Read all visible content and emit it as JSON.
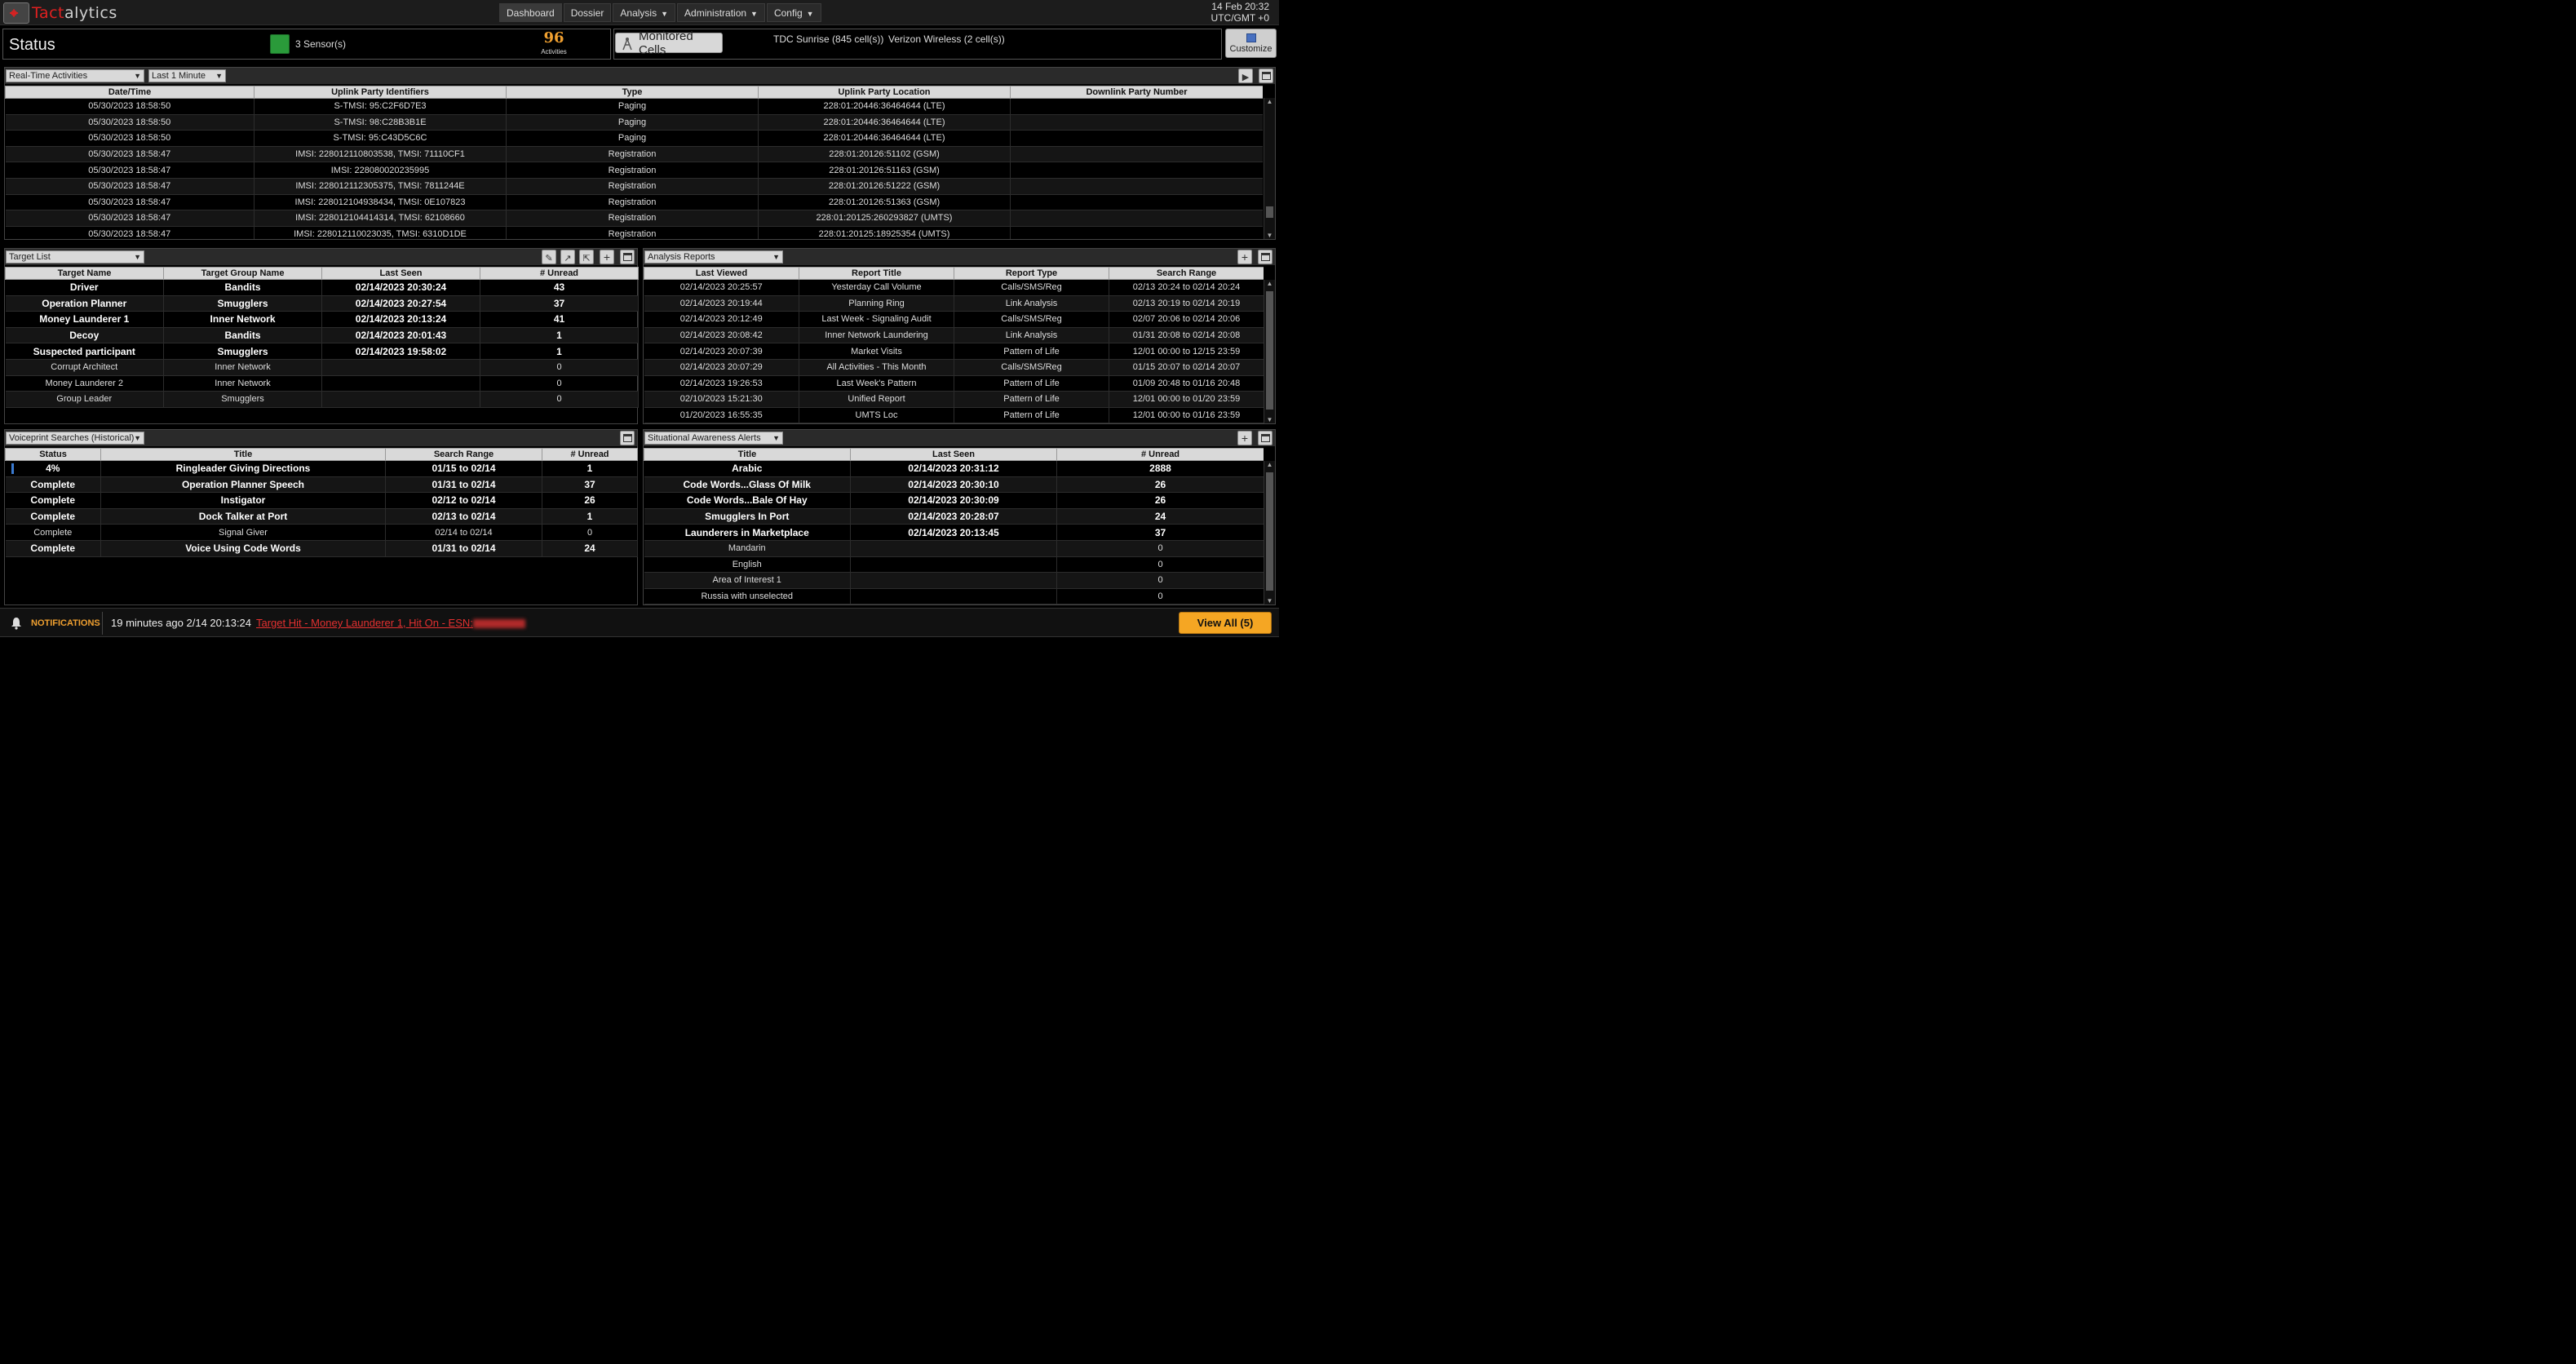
{
  "app": {
    "brand_red": "Tact",
    "brand_rest": "alytics",
    "logo_glyph": "⌖"
  },
  "nav": {
    "items": [
      {
        "label": "Dashboard",
        "dropdown": false
      },
      {
        "label": "Dossier",
        "dropdown": false
      },
      {
        "label": "Analysis",
        "dropdown": true
      },
      {
        "label": "Administration",
        "dropdown": true
      },
      {
        "label": "Config",
        "dropdown": true
      }
    ],
    "active": "Dashboard"
  },
  "clock": {
    "date": "14 Feb 20:32",
    "tz": "UTC/GMT +0"
  },
  "status": {
    "title": "Status",
    "sensors": "3 Sensor(s)",
    "sensor_color": "#2a9a3a",
    "activities_count": "96",
    "activities_label": "Activities"
  },
  "cells": {
    "button": "Monitored Cells",
    "items": [
      "TDC Sunrise (845 cell(s))",
      "Verizon Wireless (2 cell(s))"
    ]
  },
  "customize": {
    "label": "Customize"
  },
  "realtime": {
    "select": "Real-Time Activities",
    "range": "Last 1 Minute",
    "columns": [
      "Date/Time",
      "Uplink Party Identifiers",
      "Type",
      "Uplink Party Location",
      "Downlink Party Number"
    ],
    "rows": [
      [
        "05/30/2023 18:58:50",
        "S-TMSI: 95:C2F6D7E3",
        "Paging",
        "228:01:20446:36464644 (LTE)",
        ""
      ],
      [
        "05/30/2023 18:58:50",
        "S-TMSI: 98:C28B3B1E",
        "Paging",
        "228:01:20446:36464644 (LTE)",
        ""
      ],
      [
        "05/30/2023 18:58:50",
        "S-TMSI: 95:C43D5C6C",
        "Paging",
        "228:01:20446:36464644 (LTE)",
        ""
      ],
      [
        "05/30/2023 18:58:47",
        "IMSI: 228012110803538, TMSI: 71110CF1",
        "Registration",
        "228:01:20126:51102 (GSM)",
        ""
      ],
      [
        "05/30/2023 18:58:47",
        "IMSI: 228080020235995",
        "Registration",
        "228:01:20126:51163 (GSM)",
        ""
      ],
      [
        "05/30/2023 18:58:47",
        "IMSI: 228012112305375, TMSI: 7811244E",
        "Registration",
        "228:01:20126:51222 (GSM)",
        ""
      ],
      [
        "05/30/2023 18:58:47",
        "IMSI: 228012104938434, TMSI: 0E107823",
        "Registration",
        "228:01:20126:51363 (GSM)",
        ""
      ],
      [
        "05/30/2023 18:58:47",
        "IMSI: 228012104414314, TMSI: 62108660",
        "Registration",
        "228:01:20125:260293827 (UMTS)",
        ""
      ],
      [
        "05/30/2023 18:58:47",
        "IMSI: 228012110023035, TMSI: 6310D1DE",
        "Registration",
        "228:01:20125:18925354 (UMTS)",
        ""
      ]
    ]
  },
  "targets": {
    "select": "Target List",
    "columns": [
      "Target Name",
      "Target Group Name",
      "Last Seen",
      "# Unread"
    ],
    "rows": [
      {
        "cells": [
          "Driver",
          "Bandits",
          "02/14/2023 20:30:24",
          "43"
        ],
        "bold": true
      },
      {
        "cells": [
          "Operation Planner",
          "Smugglers",
          "02/14/2023 20:27:54",
          "37"
        ],
        "bold": true
      },
      {
        "cells": [
          "Money Launderer 1",
          "Inner Network",
          "02/14/2023 20:13:24",
          "41"
        ],
        "bold": true
      },
      {
        "cells": [
          "Decoy",
          "Bandits",
          "02/14/2023 20:01:43",
          "1"
        ],
        "bold": true
      },
      {
        "cells": [
          "Suspected participant",
          "Smugglers",
          "02/14/2023 19:58:02",
          "1"
        ],
        "bold": true
      },
      {
        "cells": [
          "Corrupt Architect",
          "Inner Network",
          "",
          "0"
        ],
        "bold": false
      },
      {
        "cells": [
          "Money Launderer 2",
          "Inner Network",
          "",
          "0"
        ],
        "bold": false
      },
      {
        "cells": [
          "Group Leader",
          "Smugglers",
          "",
          "0"
        ],
        "bold": false
      }
    ]
  },
  "reports": {
    "select": "Analysis Reports",
    "columns": [
      "Last Viewed",
      "Report Title",
      "Report Type",
      "Search Range"
    ],
    "rows": [
      [
        "02/14/2023 20:25:57",
        "Yesterday Call Volume",
        "Calls/SMS/Reg",
        "02/13 20:24 to 02/14 20:24"
      ],
      [
        "02/14/2023 20:19:44",
        "Planning Ring",
        "Link Analysis",
        "02/13 20:19 to 02/14 20:19"
      ],
      [
        "02/14/2023 20:12:49",
        "Last Week - Signaling Audit",
        "Calls/SMS/Reg",
        "02/07 20:06 to 02/14 20:06"
      ],
      [
        "02/14/2023 20:08:42",
        "Inner Network Laundering",
        "Link Analysis",
        "01/31 20:08 to 02/14 20:08"
      ],
      [
        "02/14/2023 20:07:39",
        "Market Visits",
        "Pattern of Life",
        "12/01 00:00 to 12/15 23:59"
      ],
      [
        "02/14/2023 20:07:29",
        "All Activities - This Month",
        "Calls/SMS/Reg",
        "01/15 20:07 to 02/14 20:07"
      ],
      [
        "02/14/2023 19:26:53",
        "Last Week's Pattern",
        "Pattern of Life",
        "01/09 20:48 to 01/16 20:48"
      ],
      [
        "02/10/2023 15:21:30",
        "Unified Report",
        "Pattern of Life",
        "12/01 00:00 to 01/20 23:59"
      ],
      [
        "01/20/2023 16:55:35",
        "UMTS Loc",
        "Pattern of Life",
        "12/01 00:00 to 01/16 23:59"
      ]
    ]
  },
  "voiceprint": {
    "select": "Voiceprint Searches (Historical)",
    "columns": [
      "Status",
      "Title",
      "Search Range",
      "# Unread"
    ],
    "rows": [
      {
        "cells": [
          "4%",
          "Ringleader Giving Directions",
          "01/15 to 02/14",
          "1"
        ],
        "bold": true,
        "progress": 0.04
      },
      {
        "cells": [
          "Complete",
          "Operation Planner Speech",
          "01/31 to 02/14",
          "37"
        ],
        "bold": true
      },
      {
        "cells": [
          "Complete",
          "Instigator",
          "02/12 to 02/14",
          "26"
        ],
        "bold": true
      },
      {
        "cells": [
          "Complete",
          "Dock Talker at Port",
          "02/13 to 02/14",
          "1"
        ],
        "bold": true
      },
      {
        "cells": [
          "Complete",
          "Signal Giver",
          "02/14 to 02/14",
          "0"
        ],
        "bold": false
      },
      {
        "cells": [
          "Complete",
          "Voice Using Code Words",
          "01/31 to 02/14",
          "24"
        ],
        "bold": true
      }
    ]
  },
  "alerts": {
    "select": "Situational Awareness Alerts",
    "columns": [
      "Title",
      "Last Seen",
      "# Unread"
    ],
    "rows": [
      {
        "cells": [
          "Arabic",
          "02/14/2023 20:31:12",
          "2888"
        ],
        "bold": true
      },
      {
        "cells": [
          "Code Words...Glass Of Milk",
          "02/14/2023 20:30:10",
          "26"
        ],
        "bold": true
      },
      {
        "cells": [
          "Code Words...Bale Of Hay",
          "02/14/2023 20:30:09",
          "26"
        ],
        "bold": true
      },
      {
        "cells": [
          "Smugglers In Port",
          "02/14/2023 20:28:07",
          "24"
        ],
        "bold": true
      },
      {
        "cells": [
          "Launderers in Marketplace",
          "02/14/2023 20:13:45",
          "37"
        ],
        "bold": true
      },
      {
        "cells": [
          "Mandarin",
          "",
          "0"
        ],
        "bold": false
      },
      {
        "cells": [
          "English",
          "",
          "0"
        ],
        "bold": false
      },
      {
        "cells": [
          "Area of Interest 1",
          "",
          "0"
        ],
        "bold": false
      },
      {
        "cells": [
          "Russia with unselected",
          "",
          "0"
        ],
        "bold": false
      }
    ]
  },
  "notifications": {
    "label": "NOTIFICATIONS",
    "time": "19 minutes ago 2/14 20:13:24",
    "message": "Target Hit - Money Launderer 1, Hit On - ESN:",
    "view_all": "View All (5)",
    "accent": "#f5a623"
  }
}
